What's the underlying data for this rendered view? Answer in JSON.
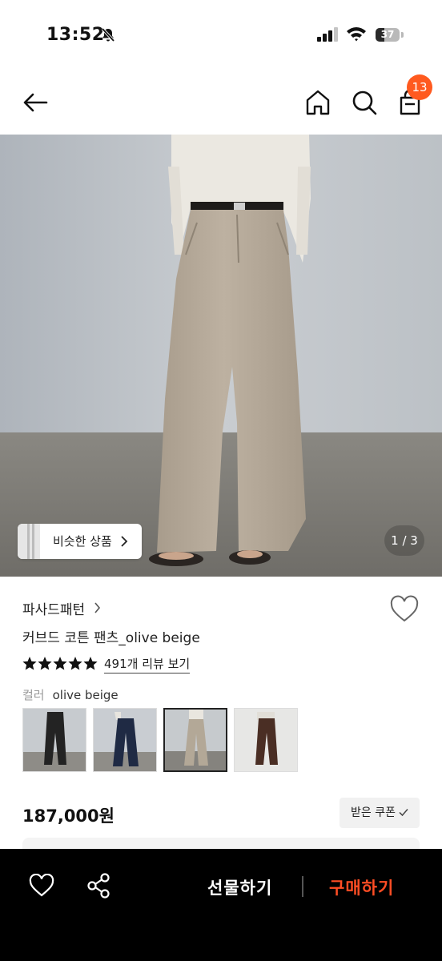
{
  "status_bar": {
    "time": "13:52",
    "battery": "37"
  },
  "header": {
    "cart_count": "13"
  },
  "gallery": {
    "similar_label": "비슷한 상품",
    "page_indicator": "1 / 3"
  },
  "product": {
    "brand": "파사드패턴",
    "name": "커브드 코튼 팬츠_olive beige",
    "rating_stars": 5,
    "reviews_link": "491개 리뷰 보기",
    "color_label": "컬러",
    "color_value": "olive beige",
    "color_options": [
      "black",
      "navy",
      "olive beige",
      "brown"
    ],
    "selected_color_index": 2,
    "price": "187,000원",
    "coupon_label": "받은 쿠폰"
  },
  "bottom_bar": {
    "gift_label": "선물하기",
    "buy_label": "구매하기"
  },
  "colors": {
    "accent": "#ff5a1f",
    "buy": "#ff4d24"
  }
}
